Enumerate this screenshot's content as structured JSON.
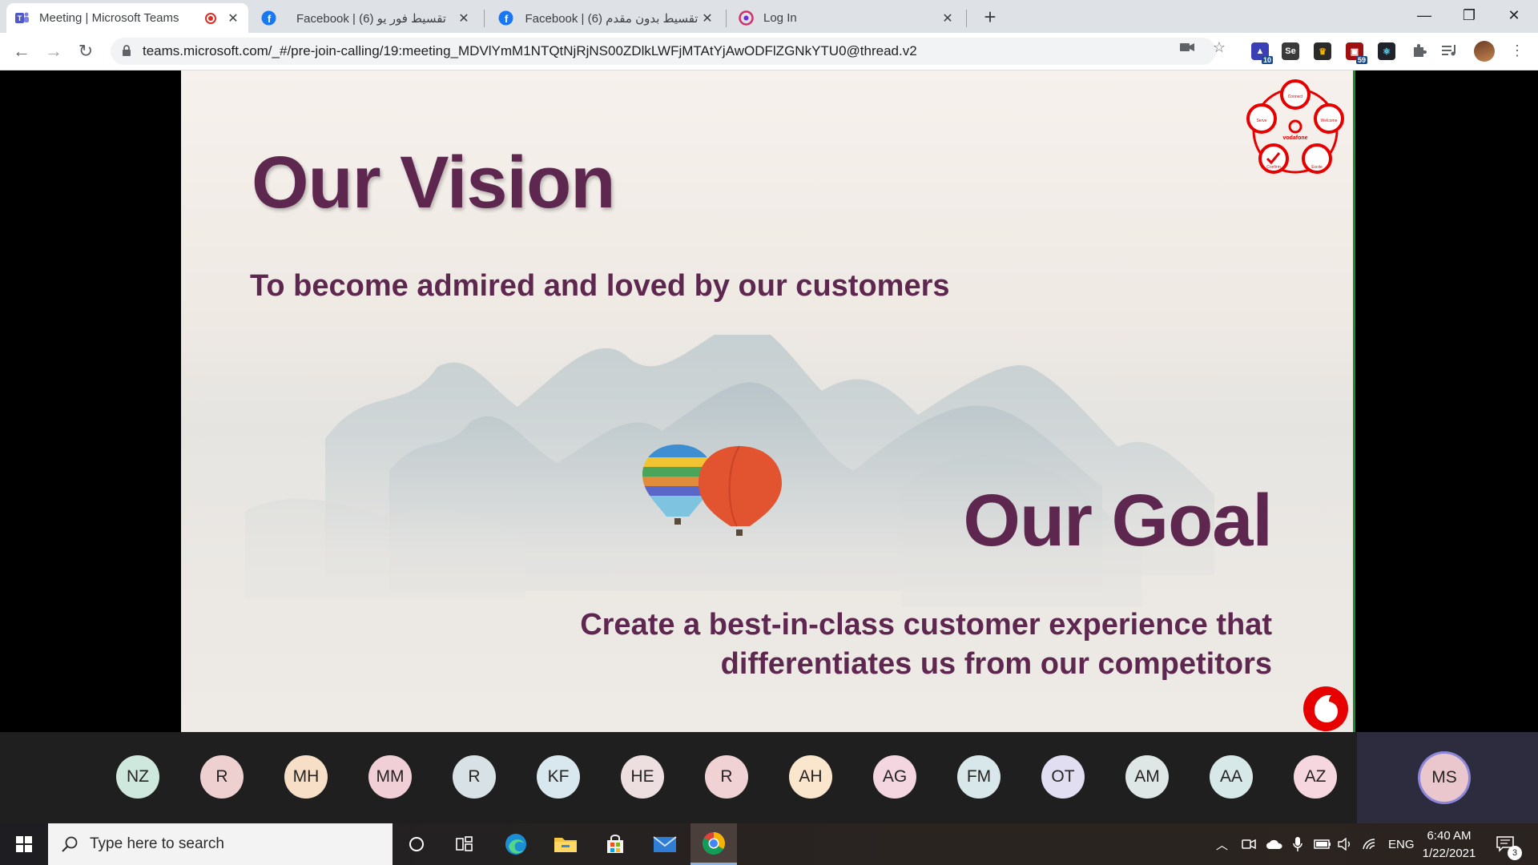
{
  "browser": {
    "tabs": [
      {
        "title": "Meeting | Microsoft Teams",
        "active": true
      },
      {
        "title": "Facebook | تقسيط فور يو (6)",
        "active": false
      },
      {
        "title": "Facebook | تقسيط بدون مقدم (6)",
        "active": false
      },
      {
        "title": "Log In",
        "active": false
      }
    ],
    "new_tab": "+",
    "url": "teams.microsoft.com/_#/pre-join-calling/19:meeting_MDVlYmM1NTQtNjRjNS00ZDlkLWFjMTAtYjAwODFlZGNkYTU0@thread.v2",
    "extensions": [
      {
        "name": "graduation-cap",
        "badge": "10",
        "color": "#3b3fb6"
      },
      {
        "name": "se",
        "label": "Se",
        "color": "#3a3a3a"
      },
      {
        "name": "crown",
        "color": "#2b2b2b"
      },
      {
        "name": "store-ext",
        "badge": "59",
        "color": "#a01010"
      },
      {
        "name": "react",
        "color": "#20232a"
      }
    ]
  },
  "slide": {
    "vision_title": "Our Vision",
    "vision_text": "To become admired and loved by our customers",
    "goal_title": "Our Goal",
    "goal_text_line1": "Create a best-in-class customer experience that",
    "goal_text_line2": "differentiates us from our competitors",
    "logo_text": "vodafone",
    "cycle_labels": [
      "Connect",
      "Welcome",
      "Excite",
      "Confirm",
      "Serve"
    ],
    "accent_color": "#5e2750",
    "brand_color": "#e60000"
  },
  "participants": [
    {
      "initials": "NZ",
      "color": "#cfe8dd"
    },
    {
      "initials": "R",
      "color": "#efd0d0"
    },
    {
      "initials": "MH",
      "color": "#f7dfc7"
    },
    {
      "initials": "MM",
      "color": "#f0d0d6"
    },
    {
      "initials": "R",
      "color": "#d8e1e5"
    },
    {
      "initials": "KF",
      "color": "#d9e7ee"
    },
    {
      "initials": "HE",
      "color": "#eddfe0"
    },
    {
      "initials": "R",
      "color": "#f0d2d4"
    },
    {
      "initials": "AH",
      "color": "#fae6cc"
    },
    {
      "initials": "AG",
      "color": "#f3d6df"
    },
    {
      "initials": "FM",
      "color": "#d8e7ea"
    },
    {
      "initials": "OT",
      "color": "#e1def2"
    },
    {
      "initials": "AM",
      "color": "#dfe6e6"
    },
    {
      "initials": "AA",
      "color": "#d7e8e8"
    },
    {
      "initials": "AZ",
      "color": "#f6d7df"
    }
  ],
  "self_participant": {
    "initials": "MS"
  },
  "taskbar": {
    "search_placeholder": "Type here to search",
    "language": "ENG",
    "time": "6:40 AM",
    "date": "1/22/2021",
    "notification_count": "3"
  }
}
